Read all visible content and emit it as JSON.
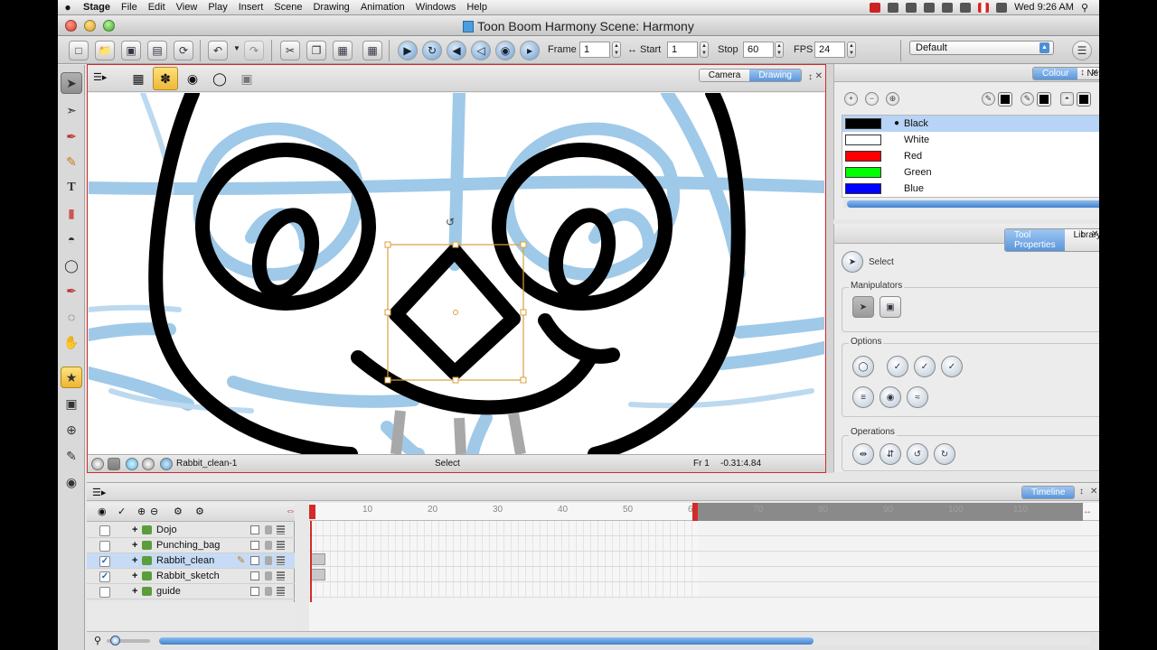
{
  "menubar": {
    "apple": "",
    "items": [
      "Stage",
      "File",
      "Edit",
      "View",
      "Play",
      "Insert",
      "Scene",
      "Drawing",
      "Animation",
      "Windows",
      "Help"
    ],
    "clock": "Wed 9:26 AM"
  },
  "window": {
    "title": "Toon Boom Harmony Scene: Harmony"
  },
  "toolbar": {
    "frame_label": "Frame",
    "frame_value": "1",
    "start_label": "Start",
    "start_value": "1",
    "stop_label": "Stop",
    "stop_value": "60",
    "fps_label": "FPS",
    "fps_value": "24",
    "workspace": "Default"
  },
  "view": {
    "tabs": [
      "Camera",
      "Drawing"
    ],
    "active_tab": "Drawing",
    "status_layer": "Rabbit_clean-1",
    "status_tool": "Select",
    "status_frame": "Fr 1",
    "status_coords": "-0.31:4.84"
  },
  "colour_panel": {
    "tabs": [
      "Colour",
      "Network"
    ],
    "active_tab": "Colour",
    "colours": [
      {
        "name": "Black",
        "hex": "#000000",
        "selected": true
      },
      {
        "name": "White",
        "hex": "#ffffff",
        "selected": false
      },
      {
        "name": "Red",
        "hex": "#ff0000",
        "selected": false
      },
      {
        "name": "Green",
        "hex": "#00ff00",
        "selected": false
      },
      {
        "name": "Blue",
        "hex": "#0000ff",
        "selected": false
      }
    ]
  },
  "tool_properties": {
    "tabs": [
      "Tool Properties",
      "Library"
    ],
    "active_tab": "Tool Properties",
    "tool_name": "Select",
    "manipulators_label": "Manipulators",
    "options_label": "Options",
    "operations_label": "Operations"
  },
  "timeline": {
    "tab": "Timeline",
    "ruler_labels": [
      "10",
      "20",
      "30",
      "40",
      "50",
      "60",
      "70",
      "80",
      "90",
      "100",
      "110"
    ],
    "layers": [
      {
        "name": "Dojo",
        "checked": false,
        "selected": false
      },
      {
        "name": "Punching_bag",
        "checked": false,
        "selected": false
      },
      {
        "name": "Rabbit_clean",
        "checked": true,
        "selected": true
      },
      {
        "name": "Rabbit_sketch",
        "checked": true,
        "selected": false
      },
      {
        "name": "guide",
        "checked": false,
        "selected": false
      }
    ]
  },
  "colors": {
    "accent": "#5a96db",
    "view_border": "#d42a2a",
    "sketch_blue": "#8fc0e4",
    "bbox": "#d8a23a"
  }
}
